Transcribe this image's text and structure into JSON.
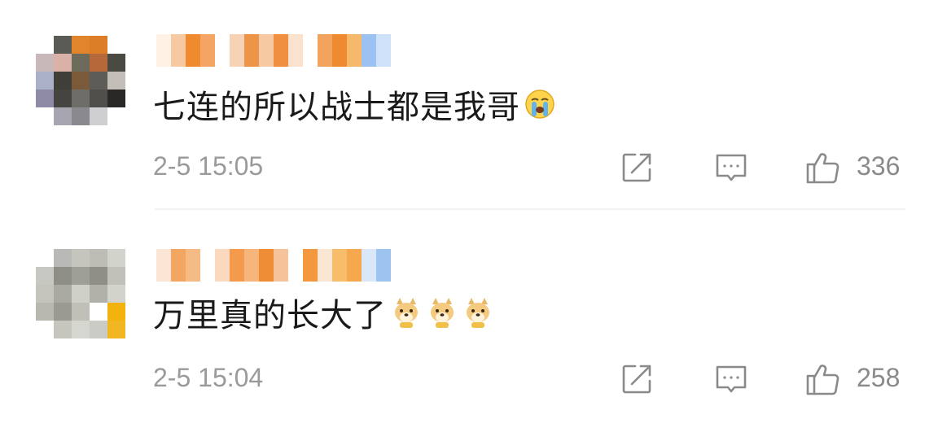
{
  "comments": [
    {
      "text": "七连的所以战士都是我哥",
      "emojis": [
        "crying-face"
      ],
      "timestamp": "2-5 15:05",
      "likes": "336"
    },
    {
      "text": "万里真的长大了",
      "emojis": [
        "doge",
        "doge",
        "doge"
      ],
      "timestamp": "2-5 15:04",
      "likes": "258"
    }
  ],
  "colors": {
    "text": "#1a1a1a",
    "meta": "#9a9a9a",
    "icon": "#8a8a8a"
  }
}
